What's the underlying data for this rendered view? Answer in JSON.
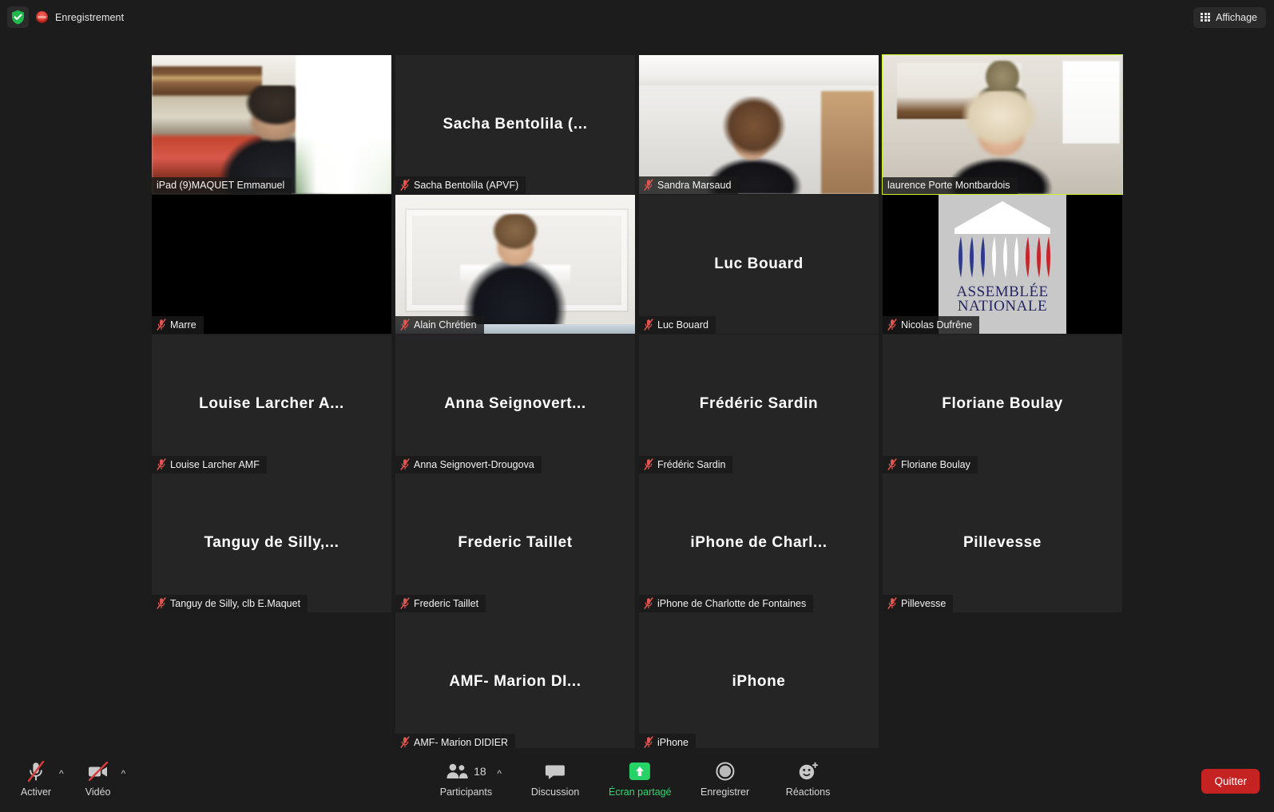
{
  "topbar": {
    "shield_icon": "shield-check-icon",
    "recording_icon": "recording-dot-icon",
    "recording_label": "Enregistrement",
    "view_icon": "grid-view-icon",
    "view_label": "Affichage"
  },
  "gallery": {
    "active_speaker_border_color": "#c9f227",
    "rows": [
      {
        "tiles": [
          {
            "name_plate": "iPad (9)MAQUET Emmanuel",
            "center_name": "",
            "muted": false,
            "active": false,
            "kind": "video",
            "video": "maquet"
          },
          {
            "name_plate": "Sacha Bentolila (APVF)",
            "center_name": "Sacha Bentolila (...",
            "muted": true,
            "active": false,
            "kind": "placeholder"
          },
          {
            "name_plate": "Sandra Marsaud",
            "center_name": "",
            "muted": true,
            "active": false,
            "kind": "video",
            "video": "sandra"
          },
          {
            "name_plate": "laurence Porte Montbardois",
            "center_name": "",
            "muted": false,
            "active": true,
            "kind": "video",
            "video": "laurence"
          }
        ]
      },
      {
        "tiles": [
          {
            "name_plate": "Marre",
            "center_name": "",
            "muted": true,
            "active": false,
            "kind": "black"
          },
          {
            "name_plate": "Alain Chrétien",
            "center_name": "",
            "muted": true,
            "active": false,
            "kind": "video",
            "video": "alain"
          },
          {
            "name_plate": "Luc Bouard",
            "center_name": "Luc Bouard",
            "muted": true,
            "active": false,
            "kind": "placeholder"
          },
          {
            "name_plate": "Nicolas Dufrêne",
            "center_name": "",
            "muted": true,
            "active": false,
            "kind": "logo",
            "logo_line1": "ASSEMBLÉE",
            "logo_line2": "NATIONALE"
          }
        ]
      },
      {
        "tiles": [
          {
            "name_plate": "Louise Larcher AMF",
            "center_name": "Louise Larcher A...",
            "muted": true,
            "active": false,
            "kind": "placeholder"
          },
          {
            "name_plate": "Anna Seignovert-Drougova",
            "center_name": "Anna Seignovert...",
            "muted": true,
            "active": false,
            "kind": "placeholder"
          },
          {
            "name_plate": "Frédéric Sardin",
            "center_name": "Frédéric Sardin",
            "muted": true,
            "active": false,
            "kind": "placeholder"
          },
          {
            "name_plate": "Floriane Boulay",
            "center_name": "Floriane Boulay",
            "muted": true,
            "active": false,
            "kind": "placeholder"
          }
        ]
      },
      {
        "tiles": [
          {
            "name_plate": "Tanguy de Silly, clb E.Maquet",
            "center_name": "Tanguy de Silly,...",
            "muted": true,
            "active": false,
            "kind": "placeholder"
          },
          {
            "name_plate": "Frederic Taillet",
            "center_name": "Frederic Taillet",
            "muted": true,
            "active": false,
            "kind": "placeholder"
          },
          {
            "name_plate": "iPhone de Charlotte de Fontaines",
            "center_name": "iPhone de Charl...",
            "muted": true,
            "active": false,
            "kind": "placeholder"
          },
          {
            "name_plate": "Pillevesse",
            "center_name": "Pillevesse",
            "muted": true,
            "active": false,
            "kind": "placeholder"
          }
        ]
      },
      {
        "tiles": [
          {
            "name_plate": "AMF- Marion DIDIER",
            "center_name": "AMF- Marion DI...",
            "muted": true,
            "active": false,
            "kind": "placeholder"
          },
          {
            "name_plate": "iPhone",
            "center_name": "iPhone",
            "muted": true,
            "active": false,
            "kind": "placeholder"
          }
        ]
      }
    ]
  },
  "toolbar": {
    "audio": {
      "icon": "microphone-muted-icon",
      "label": "Activer"
    },
    "video": {
      "icon": "camera-muted-icon",
      "label": "Vidéo"
    },
    "participants": {
      "icon": "participants-icon",
      "label": "Participants",
      "count": "18"
    },
    "chat": {
      "icon": "chat-bubble-icon",
      "label": "Discussion"
    },
    "share": {
      "icon": "share-screen-icon",
      "label": "Écran partagé",
      "color": "#2bd871"
    },
    "record": {
      "icon": "record-circle-icon",
      "label": "Enregistrer"
    },
    "reactions": {
      "icon": "reactions-smiley-icon",
      "label": "Réactions"
    },
    "leave": {
      "label": "Quitter",
      "color": "#c52222"
    }
  }
}
